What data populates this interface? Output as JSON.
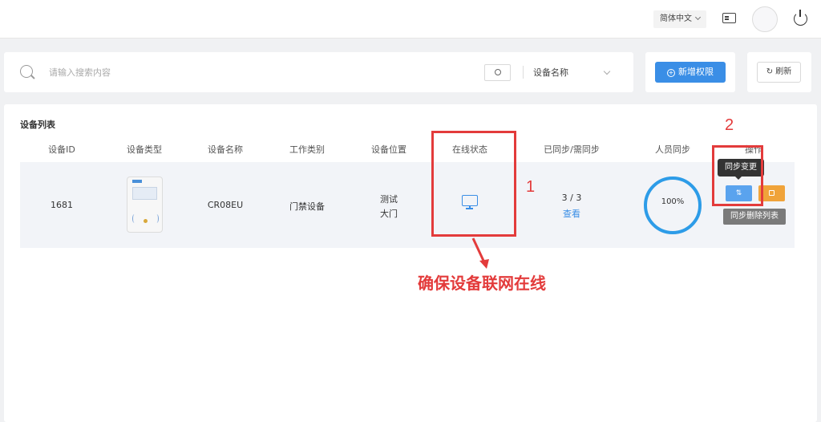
{
  "header": {
    "language": "简体中文"
  },
  "search": {
    "placeholder": "请输入搜索内容",
    "field_selected": "设备名称"
  },
  "actions": {
    "add_label": "新增权限",
    "refresh_label": "刷新"
  },
  "panel": {
    "title": "设备列表",
    "columns": [
      "设备ID",
      "设备类型",
      "设备名称",
      "工作类别",
      "设备位置",
      "在线状态",
      "已同步/需同步",
      "人员同步",
      "操作"
    ],
    "row": {
      "id": "1681",
      "name": "CR08EU",
      "work_type": "门禁设备",
      "location_line1": "测试",
      "location_line2": "大门",
      "sync_count": "3 / 3",
      "view_link": "查看",
      "person_sync": "100%",
      "person_sync_value": 1.0
    },
    "tooltip_sync": "同步变更",
    "tooltip_delete": "同步删除列表"
  },
  "annotations": {
    "label_1": "1",
    "label_2": "2",
    "callout": "确保设备联网在线",
    "color": "#e33b3b"
  },
  "colors": {
    "primary": "#3a8ee6",
    "warning": "#f0a33a"
  }
}
